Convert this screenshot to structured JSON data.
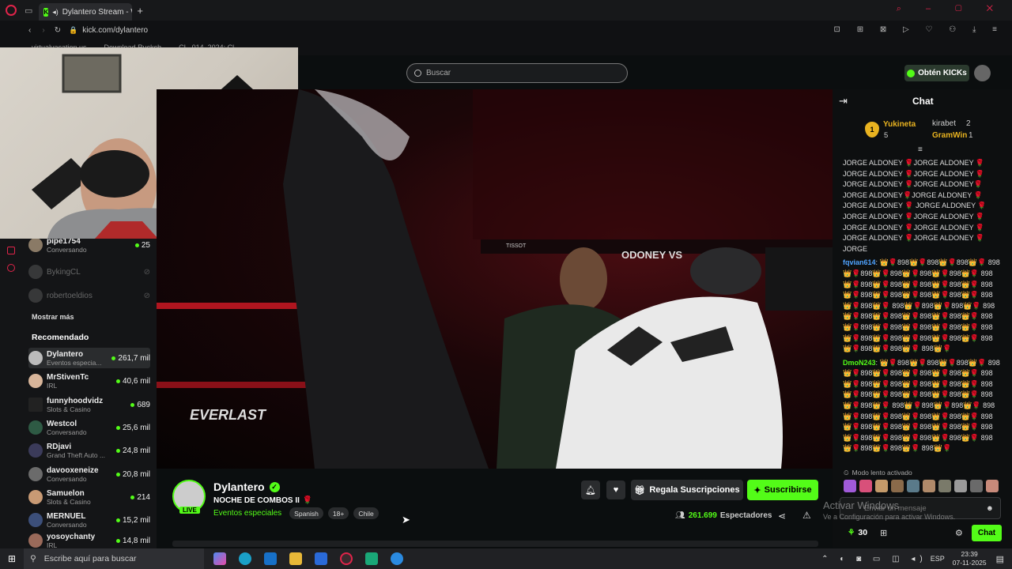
{
  "browser": {
    "tab_title": "Dylantero Stream - Wa",
    "url": "kick.com/dylantero",
    "bookmarks": [
      "virtualvacation.us",
      "Download Ruckch",
      "CL_014_2024: Cl"
    ]
  },
  "header": {
    "search_placeholder": "Buscar",
    "kicks_label": "Obtén KICKs"
  },
  "sidebar": {
    "following": [
      {
        "name": "pipe1754",
        "sub": "Conversando",
        "viewers": "25"
      },
      {
        "name": "BykingCL",
        "sub": "",
        "viewers": ""
      },
      {
        "name": "robertoeldios",
        "sub": "",
        "viewers": ""
      }
    ],
    "show_more": "Mostrar más",
    "recommended_title": "Recomendado",
    "recommended": [
      {
        "name": "Dylantero",
        "sub": "Eventos especia...",
        "viewers": "261,7 mil"
      },
      {
        "name": "MrStivenTc",
        "sub": "IRL",
        "viewers": "40,6 mil"
      },
      {
        "name": "funnyhoodvidz",
        "sub": "Slots & Casino",
        "viewers": "689"
      },
      {
        "name": "Westcol",
        "sub": "Conversando",
        "viewers": "25,6 mil"
      },
      {
        "name": "RDjavi",
        "sub": "Grand Theft Auto ...",
        "viewers": "24,8 mil"
      },
      {
        "name": "davooxeneize",
        "sub": "Conversando",
        "viewers": "20,8 mil"
      },
      {
        "name": "Samuelon",
        "sub": "Slots & Casino",
        "viewers": "214"
      },
      {
        "name": "MERNUEL",
        "sub": "Conversando",
        "viewers": "15,2 mil"
      },
      {
        "name": "yosoychanty",
        "sub": "IRL",
        "viewers": "14,8 mil"
      }
    ]
  },
  "video": {
    "brand": "EVERLAST",
    "banner": "ODONEY VS",
    "tisot": "TISSOT"
  },
  "stream": {
    "channel": "Dylantero",
    "live": "LIVE",
    "title": "NOCHE DE COMBOS II",
    "category": "Eventos especiales",
    "tags": [
      "Spanish",
      "18+",
      "Chile"
    ],
    "gift_label": "Regala Suscripciones",
    "subscribe_label": "Suscribirse",
    "viewers": "261.699",
    "viewers_label": "Espectadores"
  },
  "chat": {
    "title": "Chat",
    "leader_rank": "1",
    "leader_name": "Yukineta",
    "leader_score": "5",
    "second_name": "kirabet",
    "second_score": "2",
    "third_name": "GramWin",
    "third_score": "1",
    "msg1": "JORGE ALDONEY 🌹JORGE ALDONEY 🌹 JORGE ALDONEY 🌹JORGE ALDONEY 🌹 JORGE ALDONEY 🌹JORGE ALDONEY🌹JORGE ALDONEY🌹JORGE ALDONEY 🌹JORGE ALDONEY 🌹 JORGE ALDONEY 🌹JORGE ALDONEY 🌹JORGE ALDONEY 🌹JORGE ALDONEY 🌹JORGE ALDONEY 🌹JORGE ALDONEY 🌹JORGE ALDONEY 🌹JORGE",
    "user2": "fqvian614",
    "msg2": "👑🌹898👑🌹898👑🌹898👑🌹 898👑🌹898👑🌹898👑🌹898👑🌹898👑🌹 898👑🌹898👑🌹898👑🌹898👑🌹898👑🌹 898👑🌹898👑🌹898👑🌹898👑🌹898👑🌹 898👑🌹898👑🌹 898👑🌹898👑🌹898👑🌹 898👑🌹898👑🌹898👑🌹898👑🌹898👑🌹 898👑🌹898👑🌹898👑🌹898👑🌹898👑🌹 898👑🌹898👑🌹898👑🌹898👑🌹898👑🌹 898👑🌹898👑🌹898👑🌹 898👑🌹",
    "user3": "DmoN243",
    "msg3": "👑🌹898👑🌹898👑🌹898👑🌹 898👑🌹898👑🌹898👑🌹898👑🌹898👑🌹 898👑🌹898👑🌹898👑🌹898👑🌹898👑🌹 898👑🌹898👑🌹898👑🌹898👑🌹898👑🌹 898👑🌹898👑🌹 898👑🌹898👑🌹898👑🌹 898👑🌹898👑🌹898👑🌹898👑🌹898👑🌹 898👑🌹898👑🌹898👑🌹898👑🌹898👑🌹 898👑🌹898👑🌹898👑🌹898👑🌹898👑🌹 898👑🌹898👑🌹898👑🌹 898👑🌹",
    "slow_mode": "Modo lento activado",
    "input_placeholder": "Enviar un mensaje",
    "points": "30",
    "send_label": "Chat"
  },
  "watermark": {
    "line1": "Activar Windows",
    "line2": "Ve a Configuración para activar Windows."
  },
  "taskbar": {
    "search_placeholder": "Escribe aquí para buscar",
    "lang": "ESP",
    "time": "23:39",
    "date": "07-11-2025"
  },
  "colors": {
    "kick_green": "#53fc18",
    "opera_red": "#e0244a"
  }
}
